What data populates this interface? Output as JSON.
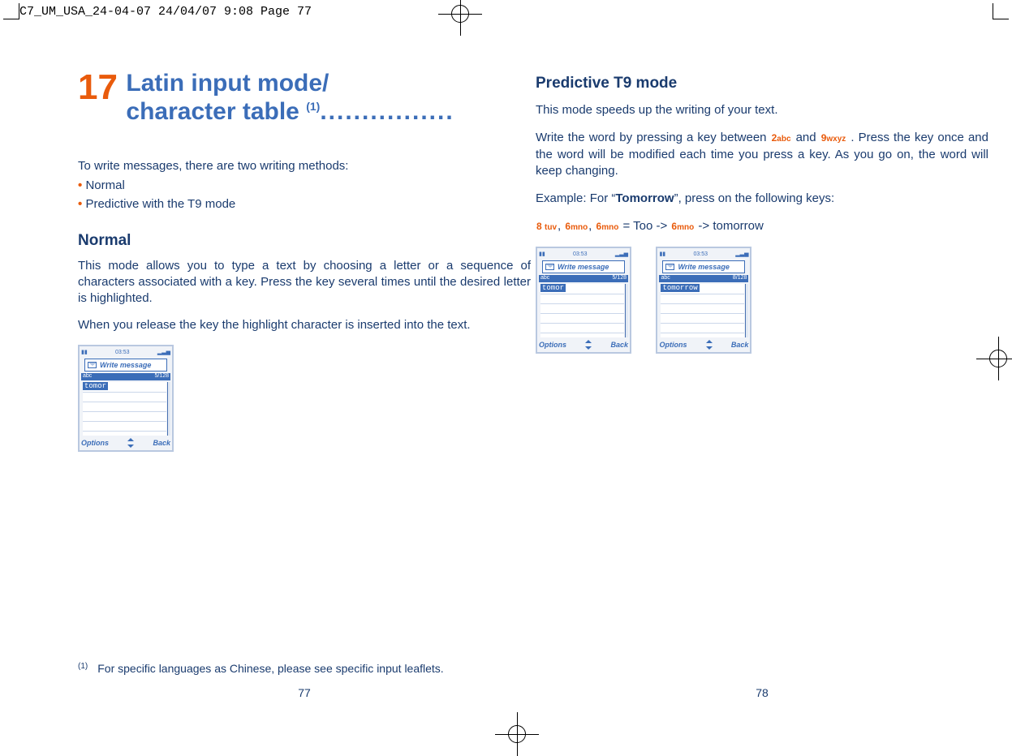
{
  "print_header": "C7_UM_USA_24-04-07  24/04/07  9:08  Page 77",
  "chapter": {
    "number": "17",
    "title_line1": "Latin input mode/",
    "title_line2": "character table ",
    "title_footnote_mark": "(1)",
    "dots": "................"
  },
  "left": {
    "intro": "To write messages, there are two writing methods:",
    "bullets": [
      "Normal",
      "Predictive with the T9 mode"
    ],
    "normal_heading": "Normal",
    "normal_p1": "This mode allows you to type a text by choosing a letter or a sequence of characters associated with a key. Press the key several times until the desired letter is highlighted.",
    "normal_p2": "When you release the key the highlight character is inserted into the text.",
    "footnote_mark": "(1)",
    "footnote_text": "For specific languages as Chinese, please see specific input leaflets.",
    "page_num": "77"
  },
  "right": {
    "t9_heading": "Predictive T9 mode",
    "t9_p1": "This mode speeds up the writing of your text.",
    "t9_p2a": "Write the word by pressing a key between ",
    "t9_p2b": " and ",
    "t9_p2c": ". Press the key once and the word will be modified each time you press a key. As you go on, the word will keep changing.",
    "key2": "2",
    "key2sub": "abc",
    "key9": "9",
    "key9sub": "wxy​z",
    "example_label": "Example: For “",
    "example_word": "Tomorrow",
    "example_after": "”, press on the following keys:",
    "seq_8": "8",
    "seq_8sub": "tuv",
    "seq_6": "6",
    "seq_6sub": "mno",
    "seq_eq": " = Too ->",
    "seq_arrow2": " -> tomorrow",
    "page_num": "78"
  },
  "phone": {
    "time": "03:53",
    "title": "Write message",
    "mode_left": "abc",
    "counter": "5/128",
    "counter2": "8/128",
    "typed1": "tomor",
    "typed2": "tomorrow",
    "soft_left": "Options",
    "soft_right": "Back"
  }
}
